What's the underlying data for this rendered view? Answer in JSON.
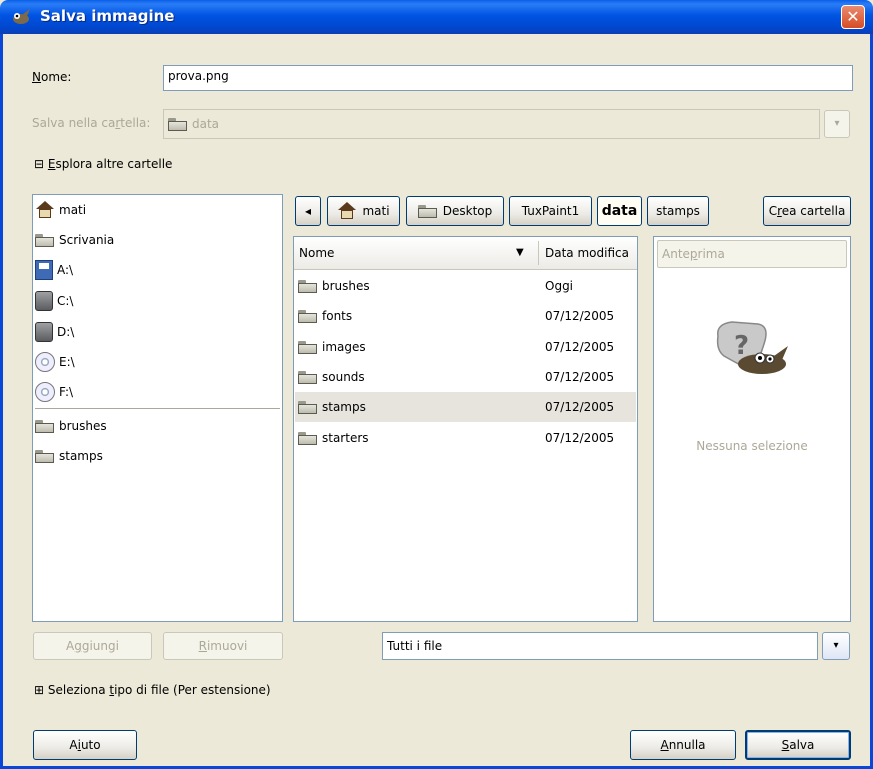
{
  "window": {
    "title": "Salva immagine",
    "close_glyph": "✕"
  },
  "name_field": {
    "label_pre": "",
    "label_mn": "N",
    "label_post": "ome:",
    "value": "prova.png"
  },
  "save_folder": {
    "label_pre": "Salva nella ca",
    "label_mn": "r",
    "label_post": "tella:",
    "value": "data",
    "arrow": "▾"
  },
  "browse_toggle": {
    "glyph": "⊟",
    "label_mn": "E",
    "label_post": "splora altre cartelle"
  },
  "places": [
    {
      "label": "mati",
      "icon": "home-icon"
    },
    {
      "label": "Scrivania",
      "icon": "folder-icon"
    },
    {
      "label": "A:\\",
      "icon": "floppy-icon"
    },
    {
      "label": "C:\\",
      "icon": "hard-drive-icon"
    },
    {
      "label": "D:\\",
      "icon": "hard-drive-icon"
    },
    {
      "label": "E:\\",
      "icon": "cd-icon"
    },
    {
      "label": "F:\\",
      "icon": "cd-icon"
    }
  ],
  "bookmarks": [
    {
      "label": "brushes",
      "icon": "folder-icon"
    },
    {
      "label": "stamps",
      "icon": "folder-icon"
    }
  ],
  "path_bar": {
    "back_glyph": "◂",
    "crumbs": [
      "mati",
      "Desktop",
      "TuxPaint1",
      "data",
      "stamps"
    ],
    "create_folder_pre": "C",
    "create_folder_mn": "r",
    "create_folder_post": "ea cartella"
  },
  "file_list": {
    "col_name": "Nome",
    "sort_glyph": "▼",
    "col_date": "Data modifica",
    "rows": [
      {
        "name": "brushes",
        "date": "Oggi"
      },
      {
        "name": "fonts",
        "date": "07/12/2005"
      },
      {
        "name": "images",
        "date": "07/12/2005"
      },
      {
        "name": "sounds",
        "date": "07/12/2005"
      },
      {
        "name": "stamps",
        "date": "07/12/2005",
        "selected": true
      },
      {
        "name": "starters",
        "date": "07/12/2005"
      }
    ]
  },
  "preview": {
    "header_pre": "Ante",
    "header_mn": "p",
    "header_post": "rima",
    "empty_text": "Nessuna selezione"
  },
  "buttons": {
    "add_pre": "A",
    "add_mn": "g",
    "add_post": "giungi",
    "remove_mn": "R",
    "remove_post": "imuovi",
    "help_pre": "A",
    "help_mn": "i",
    "help_post": "uto",
    "cancel_mn": "A",
    "cancel_post": "nnulla",
    "save_mn": "S",
    "save_post": "alva"
  },
  "filter": {
    "value": "Tutti i file",
    "arrow": "▾"
  },
  "filetype_toggle": {
    "glyph": "⊞",
    "label_pre": "Seleziona ",
    "label_mn": "t",
    "label_post": "ipo di file (Per estensione)"
  }
}
